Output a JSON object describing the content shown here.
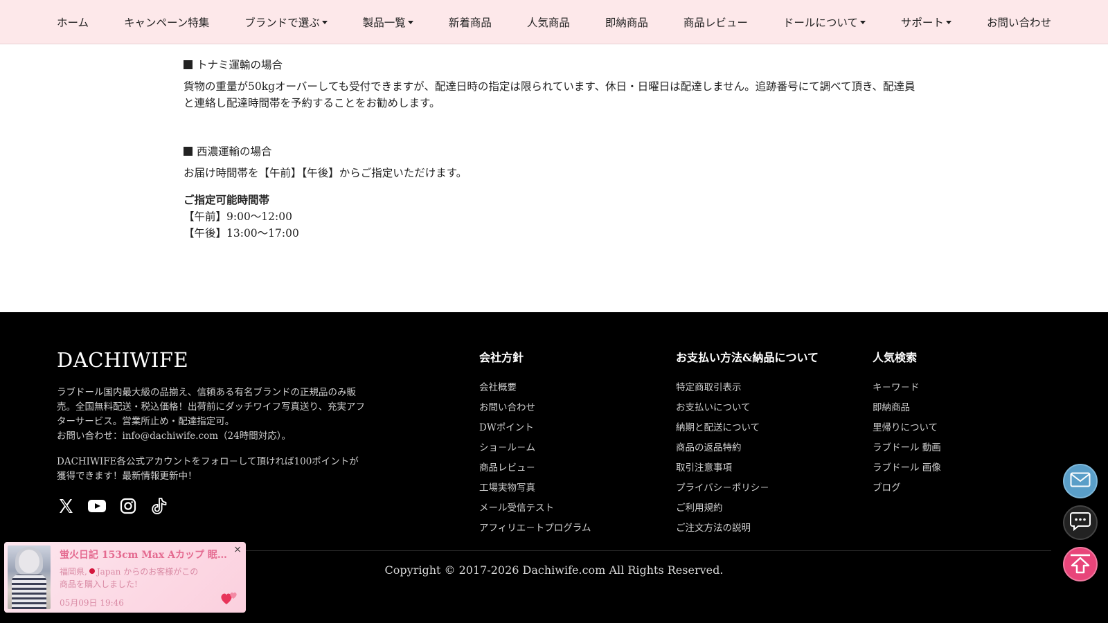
{
  "nav": {
    "items": [
      {
        "label": "ホーム",
        "dropdown": false
      },
      {
        "label": "キャンペーン特集",
        "dropdown": false
      },
      {
        "label": "ブランドで選ぶ",
        "dropdown": true
      },
      {
        "label": "製品一覧",
        "dropdown": true
      },
      {
        "label": "新着商品",
        "dropdown": false
      },
      {
        "label": "人気商品",
        "dropdown": false
      },
      {
        "label": "即納商品",
        "dropdown": false
      },
      {
        "label": "商品レビュー",
        "dropdown": false
      },
      {
        "label": "ドールについて",
        "dropdown": true
      },
      {
        "label": "サポート",
        "dropdown": true
      },
      {
        "label": "お問い合わせ",
        "dropdown": false
      }
    ]
  },
  "main": {
    "tonami": {
      "title": "トナミ運輸の場合",
      "body": "貨物の重量が50kgオーバーしても受付できますが、配達日時の指定は限られています、休日・日曜日は配達しません。追跡番号にて調べて頂き、配達員と連絡し配達時間帯を予約することをお勧めします。"
    },
    "seino": {
      "title": "西濃運輸の場合",
      "body": "お届け時間帯を【午前】【午後】からご指定いただけます。",
      "slots_heading": "ご指定可能時間帯",
      "slot_am": "【午前】9:00～12:00",
      "slot_pm": "【午後】13:00～17:00"
    }
  },
  "footer": {
    "brand": "DACHIWIFE",
    "description": "ラブドール国内最大級の品揃え、信頼ある有名ブランドの正規品のみ販売。全国無料配送・税込価格！出荷前にダッチワイフ写真送り、充実アフターサービス。営業所止め・配達指定可。",
    "contact": "お問い合わせ：info@dachiwife.com（24時間対応）。",
    "follow_text": "DACHIWIFE各公式アカウントをフォロ－して頂ければ100ポイントが獲得できます！最新情報更新中！",
    "social_icons": [
      "x-icon",
      "youtube-icon",
      "instagram-icon",
      "tiktok-icon"
    ],
    "columns": [
      {
        "title": "会社方針",
        "links": [
          "会社概要",
          "お問い合わせ",
          "DWポイント",
          "ショ－ル－ム",
          "商品レビュ－",
          "工場実物写真",
          "メール受信テスト",
          "アフィリエ－トプログラム"
        ]
      },
      {
        "title": "お支払い方法&納品について",
        "links": [
          "特定商取引表示",
          "お支払いについて",
          "納期と配送について",
          "商品の返品特約",
          "取引注意事項",
          "プライバシ－ポリシ－",
          "ご利用規約",
          "ご注文方法の説明"
        ]
      },
      {
        "title": "人気検索",
        "links": [
          "キ－ワ－ド",
          "即納商品",
          "里帰りについて",
          "ラブドール 動画",
          "ラブドール 画像",
          "ブログ"
        ]
      }
    ],
    "copyright": "Copyright © 2017-2026 Dachiwife.com All Rights Reserved."
  },
  "floating": {
    "icons": [
      "mail-icon",
      "chat-icon",
      "back-to-top-icon"
    ]
  },
  "toast": {
    "title": "蛍火日記 153cm Max Aカップ 眠り目 ...",
    "location_prefix": "福岡県,",
    "location_country": "Japan",
    "message_suffix": "からのお客様がこの商品を購入しました!",
    "date": "05月09日 19:46",
    "close": "×"
  },
  "colors": {
    "nav_bg": "#fde8ea",
    "footer_bg": "#000000",
    "accent_pink": "#e46a90",
    "mail_blue": "#5a9ec8",
    "top_pink": "#e8457a"
  }
}
